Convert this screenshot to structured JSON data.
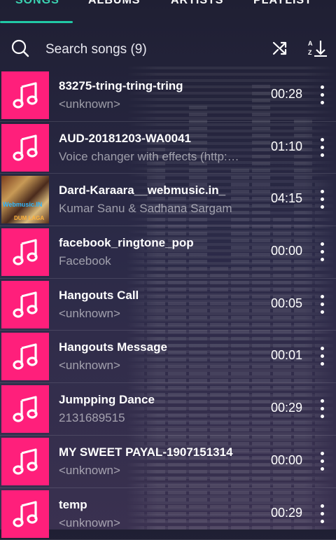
{
  "tabs": [
    {
      "label": "SONGS",
      "active": true
    },
    {
      "label": "ALBUMS",
      "active": false
    },
    {
      "label": "ARTISTS",
      "active": false
    },
    {
      "label": "PLAYLIST",
      "active": false
    }
  ],
  "search": {
    "text": "Search songs (9)"
  },
  "icons": {
    "search": "search-icon",
    "shuffle": "shuffle-icon",
    "sort": "sort-az-icon",
    "more": "more-vert-icon",
    "note": "music-note-icon"
  },
  "colors": {
    "accent": "#21c9a5",
    "thumb": "#ff1f7b"
  },
  "songs": [
    {
      "title": "83275-tring-tring-tring",
      "subtitle": "<unknown>",
      "duration": "00:28",
      "art": false
    },
    {
      "title": "AUD-20181203-WA0041",
      "subtitle": "Voice changer with effects (http:…",
      "duration": "01:10",
      "art": false
    },
    {
      "title": "Dard-Karaara__webmusic.in_",
      "subtitle": "Kumar Sanu & Sadhana Sargam",
      "duration": "04:15",
      "art": true,
      "art_text": "Webmusic.IN",
      "art_text2": "DUM LAGA"
    },
    {
      "title": "facebook_ringtone_pop",
      "subtitle": "Facebook",
      "duration": "00:00",
      "art": false
    },
    {
      "title": "Hangouts Call",
      "subtitle": "<unknown>",
      "duration": "00:05",
      "art": false
    },
    {
      "title": "Hangouts Message",
      "subtitle": "<unknown>",
      "duration": "00:01",
      "art": false
    },
    {
      "title": "Jumpping Dance",
      "subtitle": "2131689515",
      "duration": "00:29",
      "art": false
    },
    {
      "title": "MY SWEET PAYAL-1907151314",
      "subtitle": "<unknown>",
      "duration": "00:00",
      "art": false
    },
    {
      "title": "temp",
      "subtitle": "<unknown>",
      "duration": "00:29",
      "art": false
    }
  ]
}
